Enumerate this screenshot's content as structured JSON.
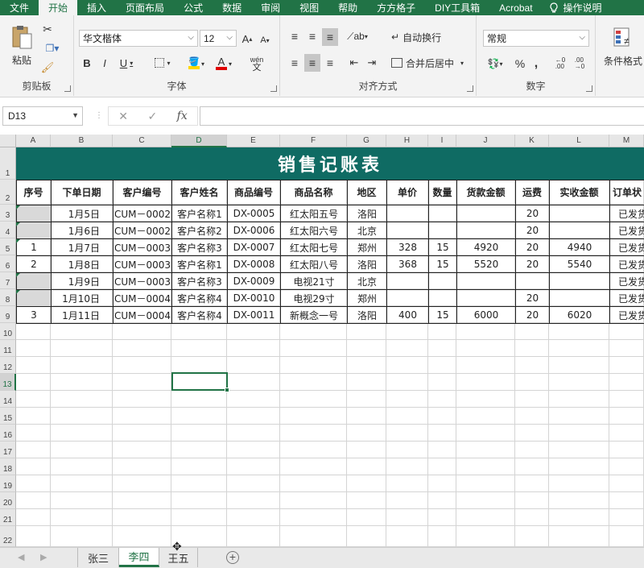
{
  "menu": {
    "tabs": [
      "文件",
      "开始",
      "插入",
      "页面布局",
      "公式",
      "数据",
      "审阅",
      "视图",
      "帮助",
      "方方格子",
      "DIY工具箱",
      "Acrobat"
    ],
    "active_index": 1,
    "help": "操作说明"
  },
  "ribbon": {
    "clipboard": {
      "label": "剪贴板",
      "paste": "粘贴"
    },
    "font": {
      "label": "字体",
      "name": "华文楷体",
      "size": "12",
      "grow": "A",
      "shrink": "A",
      "bold": "B",
      "italic": "I",
      "underline": "U",
      "wen": "wén",
      "wen2": "文"
    },
    "align": {
      "label": "对齐方式",
      "wrap": "自动换行",
      "merge": "合并后居中"
    },
    "number": {
      "label": "数字",
      "format": "常规",
      "percent": "%",
      "comma": ","
    },
    "styles": {
      "cond": "条件格式"
    }
  },
  "formula_bar": {
    "cell_ref": "D13",
    "cancel": "✕",
    "enter": "✓",
    "fx": "fx",
    "value": ""
  },
  "columns": [
    "A",
    "B",
    "C",
    "D",
    "E",
    "F",
    "G",
    "H",
    "I",
    "J",
    "K",
    "L",
    "M"
  ],
  "rows": [
    "1",
    "2",
    "3",
    "4",
    "5",
    "6",
    "7",
    "8",
    "9",
    "10",
    "11",
    "12",
    "13",
    "14",
    "15",
    "16",
    "17",
    "18",
    "19",
    "20",
    "21",
    "22"
  ],
  "sheet": {
    "title": "销售记账表",
    "headers": [
      "序号",
      "下单日期",
      "客户编号",
      "客户姓名",
      "商品编号",
      "商品名称",
      "地区",
      "单价",
      "数量",
      "货款金额",
      "运费",
      "实收金额",
      "订单状"
    ],
    "data": [
      [
        "",
        "1月5日",
        "CUM－0002",
        "客户名称1",
        "DX-0005",
        "红太阳五号",
        "洛阳",
        "",
        "",
        "",
        "20",
        "",
        "已发货"
      ],
      [
        "",
        "1月6日",
        "CUM－0002",
        "客户名称2",
        "DX-0006",
        "红太阳六号",
        "北京",
        "",
        "",
        "",
        "20",
        "",
        "已发货"
      ],
      [
        "1",
        "1月7日",
        "CUM－0003",
        "客户名称3",
        "DX-0007",
        "红太阳七号",
        "郑州",
        "328",
        "15",
        "4920",
        "20",
        "4940",
        "已发货"
      ],
      [
        "2",
        "1月8日",
        "CUM－0003",
        "客户名称1",
        "DX-0008",
        "红太阳八号",
        "洛阳",
        "368",
        "15",
        "5520",
        "20",
        "5540",
        "已发货"
      ],
      [
        "",
        "1月9日",
        "CUM－0003",
        "客户名称3",
        "DX-0009",
        "电视21寸",
        "北京",
        "",
        "",
        "",
        "",
        "",
        "已发货"
      ],
      [
        "",
        "1月10日",
        "CUM－0004",
        "客户名称4",
        "DX-0010",
        "电视29寸",
        "郑州",
        "",
        "",
        "",
        "20",
        "",
        "已发货"
      ],
      [
        "3",
        "1月11日",
        "CUM－0004",
        "客户名称4",
        "DX-0011",
        "新概念一号",
        "洛阳",
        "400",
        "15",
        "6000",
        "20",
        "6020",
        "已发货"
      ]
    ]
  },
  "selected_cell": "D13",
  "sheet_tabs": [
    "张三",
    "李四",
    "王五"
  ],
  "active_sheet": "李四",
  "colors": {
    "accent": "#217346",
    "title_band": "#0f6b63",
    "empty_seq": "#d9d9d9"
  }
}
